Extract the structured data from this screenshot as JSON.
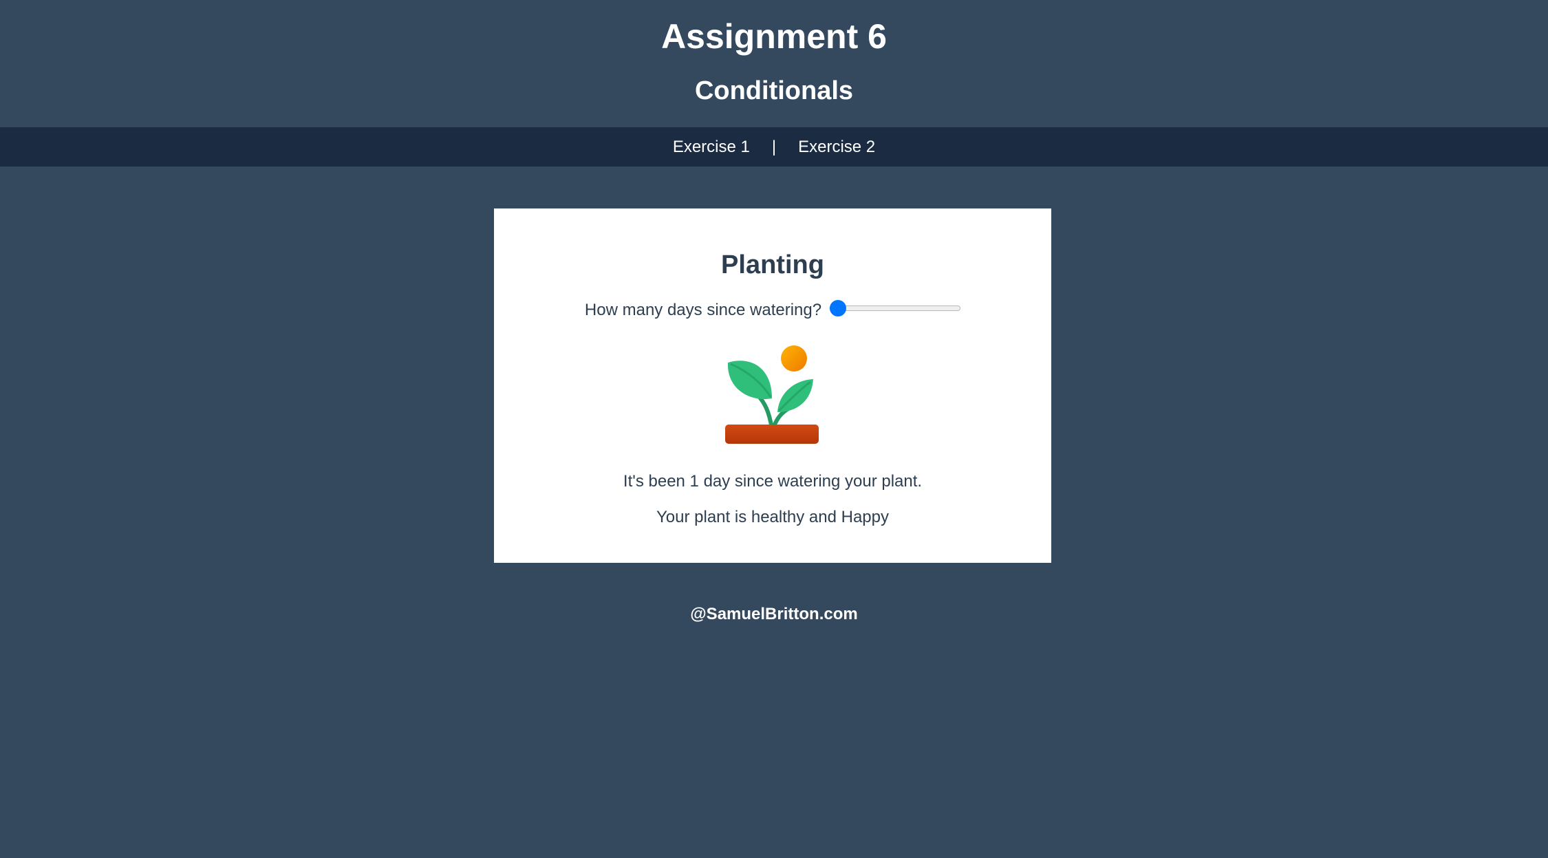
{
  "header": {
    "title": "Assignment 6",
    "subtitle": "Conditionals"
  },
  "nav": {
    "items": [
      {
        "label": "Exercise 1"
      },
      {
        "label": "Exercise 2"
      }
    ],
    "separator": "|"
  },
  "card": {
    "title": "Planting",
    "question": "How many days since watering?",
    "slider": {
      "value": 1,
      "level": 0.0
    },
    "plant_icon": "seedling-icon",
    "status_days": "It's been 1 day since watering your plant.",
    "status_health": "Your plant is healthy and Happy"
  },
  "footer": {
    "text": "@SamuelBritton.com"
  },
  "colors": {
    "background": "#35495e",
    "nav_background": "#1a2b42",
    "card_background": "#ffffff",
    "text_dark": "#2c3e50",
    "accent": "#0075ff",
    "leaf_green": "#2fbf7a",
    "soil": "#c7400f",
    "sun": "#f5a000"
  }
}
